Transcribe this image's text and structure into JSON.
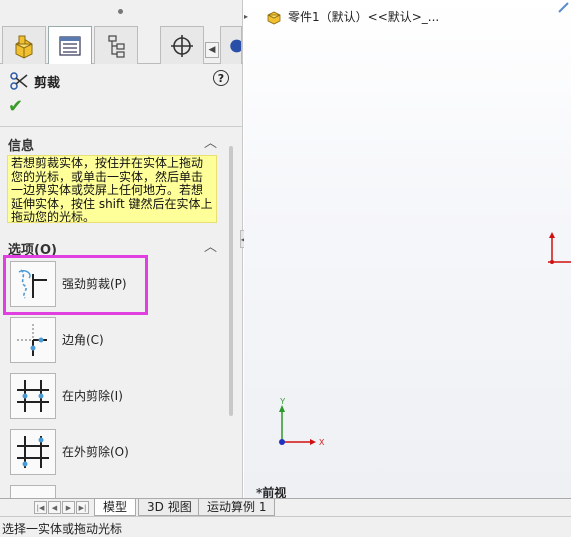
{
  "tabs": [
    {
      "name": "feature-manager",
      "icon": "part-tree-icon"
    },
    {
      "name": "property-manager",
      "icon": "property-manager-icon",
      "active": true
    },
    {
      "name": "configuration-manager",
      "icon": "configuration-icon"
    },
    {
      "name": "dim-expert",
      "icon": "dimxpert-icon"
    }
  ],
  "property_manager": {
    "title": "剪裁",
    "confirm_icon": "check-icon",
    "help_icon": "?",
    "info_group": {
      "header": "信息",
      "text": "若想剪裁实体，按住并在实体上拖动您的光标，或单击一实体，然后单击一边界实体或荧屏上任何地方。若想延伸实体，按住 shift 键然后在实体上拖动您的光标。"
    },
    "options_group": {
      "header": "选项(O)",
      "options": [
        {
          "label": "强劲剪裁(P)",
          "icon": "power-trim-icon",
          "selected": true
        },
        {
          "label": "边角(C)",
          "icon": "corner-trim-icon"
        },
        {
          "label": "在内剪除(I)",
          "icon": "trim-away-inside-icon"
        },
        {
          "label": "在外剪除(O)",
          "icon": "trim-away-outside-icon"
        }
      ]
    }
  },
  "graphics": {
    "tree_root_label": "零件1（默认）<<默认>_...",
    "view_orientation": "*前视",
    "triad": {
      "x": "X",
      "y": "Y"
    }
  },
  "bottom_tabs": [
    "模型",
    "3D 视图",
    "运动算例 1"
  ],
  "status_bar": {
    "text": "选择一实体或拖动光标"
  },
  "colors": {
    "highlight": "#e040e0",
    "info_bg": "#ffff99",
    "confirm": "#3a9b2a"
  }
}
